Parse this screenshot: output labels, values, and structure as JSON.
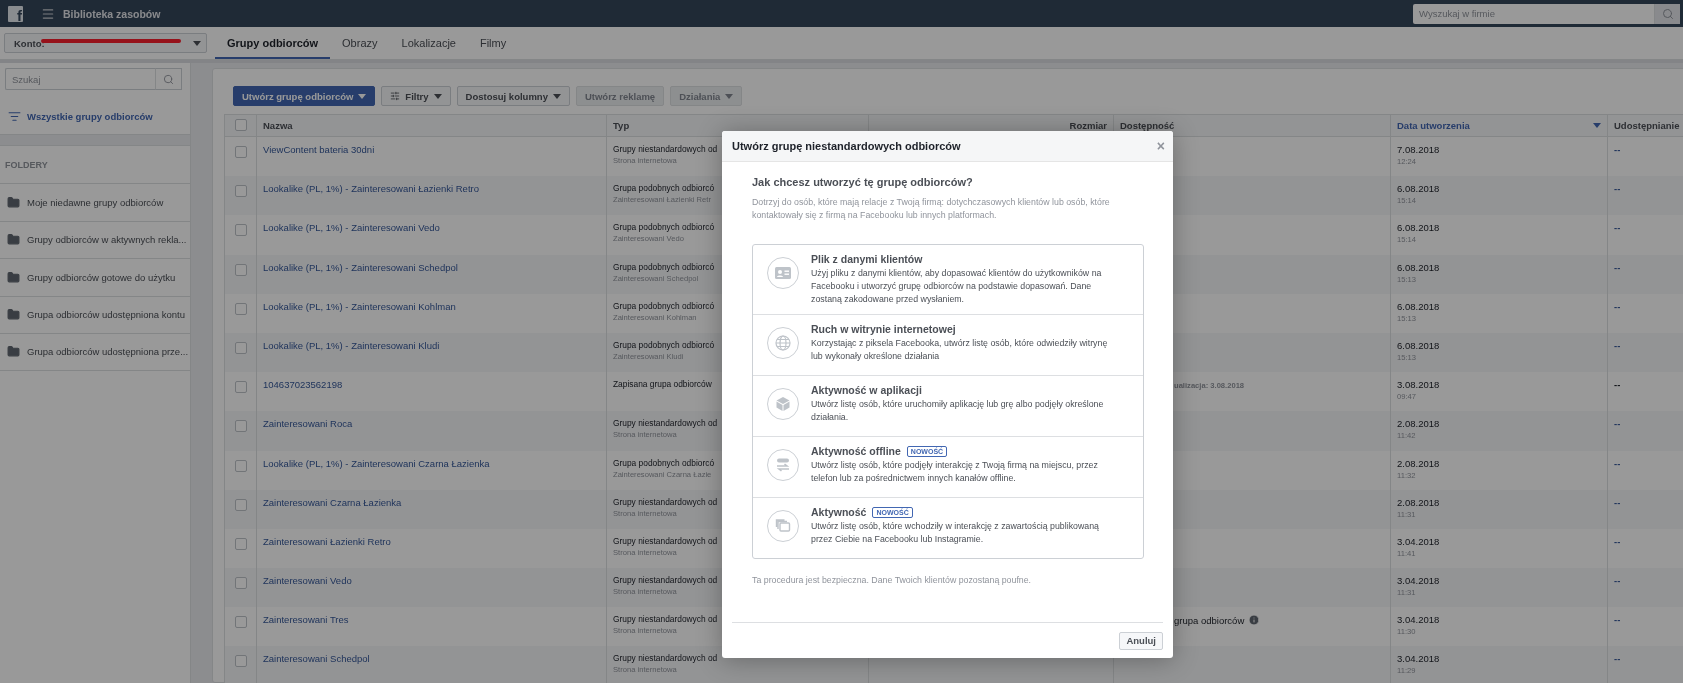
{
  "topbar": {
    "logo": "f",
    "title": "Biblioteka zasobów",
    "search_placeholder": "Wyszukaj w firmie"
  },
  "account": {
    "label": "Konto:"
  },
  "tabs": [
    {
      "label": "Grupy odbiorców",
      "selected": true
    },
    {
      "label": "Obrazy",
      "selected": false
    },
    {
      "label": "Lokalizacje",
      "selected": false
    },
    {
      "label": "Filmy",
      "selected": false
    }
  ],
  "sidebar": {
    "search_placeholder": "Szukaj",
    "all_item": {
      "label": "Wszystkie grupy odbiorców",
      "selected": true
    },
    "folders_heading": "FOLDERY",
    "folders": [
      {
        "label": "Moje niedawne grupy odbiorców",
        "selected": false
      },
      {
        "label": "Grupy odbiorców w aktywnych rekla...",
        "selected": false
      },
      {
        "label": "Grupy odbiorców gotowe do użytku",
        "selected": false
      },
      {
        "label": "Grupa odbiorców udostępniona kontu",
        "selected": false
      },
      {
        "label": "Grupa odbiorców udostępniona prze...",
        "selected": false
      }
    ]
  },
  "toolbar": [
    {
      "label": "Utwórz grupę odbiorców",
      "kind": "primary",
      "menu": true,
      "disabled": false
    },
    {
      "label": "Filtry",
      "kind": "filter",
      "menu": true,
      "disabled": false
    },
    {
      "label": "Dostosuj kolumny",
      "kind": "plain",
      "menu": true,
      "disabled": false
    },
    {
      "label": "Utwórz reklamę",
      "kind": "plain",
      "menu": false,
      "disabled": true
    },
    {
      "label": "Działania",
      "kind": "plain",
      "menu": true,
      "disabled": true
    }
  ],
  "table": {
    "select_all": {
      "checked": false
    },
    "columns": [
      {
        "label": "Nazwa",
        "sorted": false
      },
      {
        "label": "Typ",
        "sorted": false
      },
      {
        "label": "Rozmiar",
        "sorted": false
      },
      {
        "label": "Dostępność",
        "sorted": false
      },
      {
        "label": "Data utworzenia",
        "sorted": true
      },
      {
        "label": "Udostępnianie",
        "sorted": false
      }
    ],
    "rows": [
      {
        "checked": false,
        "name": "ViewContent bateria 30dni",
        "type": "Grupy niestandardowych od",
        "subtype": "Strona internetowa",
        "date": "7.08.2018",
        "time": "12:24",
        "sharing": {
          "text": "--",
          "link": true
        }
      },
      {
        "checked": false,
        "name": "Lookalike (PL, 1%) - Zainteresowani Łazienki Retro",
        "type": "Grupa podobnych odbiorcó",
        "subtype": "Zainteresowani Łazienki Retr",
        "date": "6.08.2018",
        "time": "15:14",
        "sharing": {
          "text": "--",
          "link": true
        }
      },
      {
        "checked": false,
        "name": "Lookalike (PL, 1%) - Zainteresowani Vedo",
        "type": "Grupa podobnych odbiorcó",
        "subtype": "Zainteresowani Vedo",
        "date": "6.08.2018",
        "time": "15:14",
        "sharing": {
          "text": "--",
          "link": true
        }
      },
      {
        "checked": false,
        "name": "Lookalike (PL, 1%) - Zainteresowani Schedpol",
        "type": "Grupa podobnych odbiorcó",
        "subtype": "Zainteresowani Schedpol",
        "date": "6.08.2018",
        "time": "15:13",
        "sharing": {
          "text": "--",
          "link": true
        }
      },
      {
        "checked": false,
        "name": "Lookalike (PL, 1%) - Zainteresowani Kohlman",
        "type": "Grupa podobnych odbiorcó",
        "subtype": "Zainteresowani Kohlman",
        "date": "6.08.2018",
        "time": "15:13",
        "sharing": {
          "text": "--",
          "link": true
        }
      },
      {
        "checked": false,
        "name": "Lookalike (PL, 1%) - Zainteresowani Kludi",
        "type": "Grupa podobnych odbiorcó",
        "subtype": "Zainteresowani Kludi",
        "date": "6.08.2018",
        "time": "15:13",
        "sharing": {
          "text": "--",
          "link": true
        }
      },
      {
        "checked": false,
        "name": "104637023562198",
        "type": "Zapisana grupa odbiorców",
        "availability": {
          "kind": "note",
          "text": "ualizacja: 3.08.2018"
        },
        "date": "3.08.2018",
        "time": "09:47",
        "sharing": {
          "text": "--",
          "link": false
        }
      },
      {
        "checked": false,
        "name": "Zainteresowani Roca",
        "type": "Grupy niestandardowych od",
        "subtype": "Strona internetowa",
        "date": "2.08.2018",
        "time": "11:42",
        "sharing": {
          "text": "--",
          "link": true
        }
      },
      {
        "checked": false,
        "name": "Lookalike (PL, 1%) - Zainteresowani Czarna Łazienka",
        "type": "Grupa podobnych odbiorcó",
        "subtype": "Zainteresowani Czarna Łazie",
        "date": "2.08.2018",
        "time": "11:32",
        "sharing": {
          "text": "--",
          "link": true
        }
      },
      {
        "checked": false,
        "name": "Zainteresowani Czarna Łazienka",
        "type": "Grupy niestandardowych od",
        "subtype": "Strona internetowa",
        "date": "2.08.2018",
        "time": "11:31",
        "sharing": {
          "text": "--",
          "link": true
        }
      },
      {
        "checked": false,
        "name": "Zainteresowani Łazienki Retro",
        "type": "Grupy niestandardowych od",
        "subtype": "Strona internetowa",
        "date": "3.04.2018",
        "time": "11:41",
        "sharing": {
          "text": "--",
          "link": true
        }
      },
      {
        "checked": false,
        "name": "Zainteresowani Vedo",
        "type": "Grupy niestandardowych od",
        "subtype": "Strona internetowa",
        "date": "3.04.2018",
        "time": "11:31",
        "sharing": {
          "text": "--",
          "link": true
        }
      },
      {
        "checked": false,
        "name": "Zainteresowani Tres",
        "type": "Grupy niestandardowych od",
        "subtype": "Strona internetowa",
        "availability": {
          "kind": "label",
          "text": "grupa odbiorców",
          "info": true
        },
        "date": "3.04.2018",
        "time": "11:30",
        "sharing": {
          "text": "--",
          "link": true
        }
      },
      {
        "checked": false,
        "name": "Zainteresowani Schedpol",
        "type": "Grupy niestandardowych od",
        "subtype": "Strona internetowa",
        "date": "3.04.2018",
        "time": "11:29",
        "sharing": {
          "text": "--",
          "link": true
        }
      }
    ]
  },
  "modal": {
    "title": "Utwórz grupę niestandardowych odbiorców",
    "close": "×",
    "question": "Jak chcesz utworzyć tę grupę odbiorców?",
    "description": "Dotrzyj do osób, które mają relacje z Twoją firmą: dotychczasowych klientów lub osób, które kontaktowały się z firmą na Facebooku lub innych platformach.",
    "options": [
      {
        "kind": "file",
        "title": "Plik z danymi klientów",
        "text": "Użyj pliku z danymi klientów, aby dopasować klientów do użytkowników na Facebooku i utworzyć grupę odbiorców na podstawie dopasowań. Dane zostaną zakodowane przed wysłaniem."
      },
      {
        "kind": "web",
        "title": "Ruch w witrynie internetowej",
        "text": "Korzystając z piksela Facebooka, utwórz listę osób, które odwiedziły witrynę lub wykonały określone działania"
      },
      {
        "kind": "app",
        "title": "Aktywność w aplikacji",
        "text": "Utwórz listę osób, które uruchomiły aplikację lub grę albo podjęły określone działania."
      },
      {
        "kind": "offline",
        "title": "Aktywność offline",
        "badge": "NOWOŚĆ",
        "text": "Utwórz listę osób, które podjęły interakcję z Twoją firmą na miejscu, przez telefon lub za pośrednictwem innych kanałów offline."
      },
      {
        "kind": "engagement",
        "title": "Aktywność",
        "badge": "NOWOŚĆ",
        "text": "Utwórz listę osób, które wchodziły w interakcję z zawartością publikowaną przez Ciebie na Facebooku lub Instagramie."
      }
    ],
    "note": "Ta procedura jest bezpieczna. Dane Twoich klientów pozostaną poufne.",
    "cancel": "Anuluj"
  }
}
